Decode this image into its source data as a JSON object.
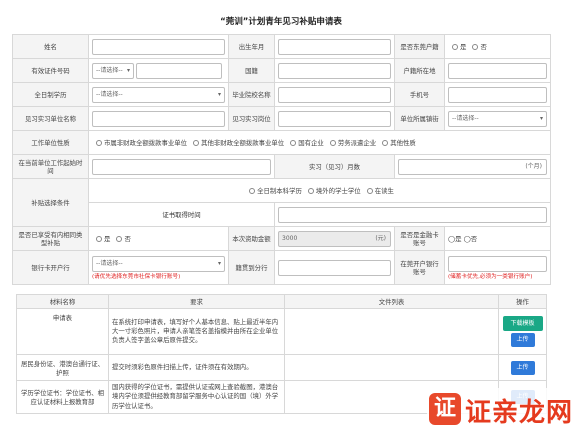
{
  "title": "“莞训”计划青年见习补贴申请表",
  "labels": {
    "name": "姓名",
    "birth": "出生年月",
    "dongguan_hukou": "是否东莞户籍",
    "id_type": "有效证件号码",
    "nationality": "国籍",
    "hukou_location": "户籍所在地",
    "education": "全日制学历",
    "school": "毕业院校名称",
    "phone": "手机号",
    "unit_name": "见习实习单位名称",
    "position": "见习实习岗位",
    "unit_town": "单位所属镇街",
    "unit_nature": "工作单位性质",
    "start_time": "在当前单位工作起始时间",
    "months": "实习（见习）月数",
    "subsidy_cond": "补贴选择条件",
    "cert_time": "证书取得时间",
    "enjoyed_other": "是否已享受有内相同类型补贴",
    "amount": "本次资助金额",
    "bank_card": "是否是金融卡账号",
    "bank_branch": "银行卡开户行",
    "city_branch": "籍贯到分行",
    "dongguan_bank": "在莞开户银行账号"
  },
  "placeholders": {
    "id_select": "--请选择--",
    "education_select": "--请选择--",
    "town_select": "--请选择--",
    "bank_select": "--请选择--"
  },
  "radios": {
    "yes": "是",
    "no": "否",
    "yes_no_compact": "◯是 ◯否"
  },
  "unit_natures": [
    "市属非财政全额拨款事业单位",
    "其他非财政全额拨款事业单位",
    "国有企业",
    "劳务派遣企业",
    "其他性质"
  ],
  "subsidy_options": [
    "全日制本科学历",
    "境外的学士学位",
    "在读生"
  ],
  "values": {
    "months_unit": "(个月)",
    "amount": "3000",
    "amount_unit": "(元)"
  },
  "hints": {
    "bank_hint": "(请优先选择东莞市社保卡银行账号)",
    "dongguan_hint": "(储蓄卡优先,必须为一类银行账户)"
  },
  "docs": {
    "headers": [
      "材料名称",
      "要求",
      "文件列表",
      "操作"
    ],
    "rows": [
      {
        "name": "申请表",
        "requirement": "在系统打印申请表，填写好个人基本信息、贴上最近半年内大一寸彩色照片，申请人亲笔签名盖指模并由所在企业单位负责人签字盖公章后原件提交。",
        "download": "下载模板",
        "upload": "上传"
      },
      {
        "name": "居民身份证、港澳台通行证、护照",
        "requirement": "提交时须彩色原件扫描上传，证件须在有效期内。",
        "upload": "上传"
      },
      {
        "name": "学历学位证书：学位证书、相应认证材料上报教育部",
        "requirement": "国内获得的学位证书，需提供认证或网上查验截图，港澳台境内学位须提供经教育部留学服务中心认证的国（境）外学历学位认证书。",
        "upload": "上传"
      }
    ]
  },
  "watermark": "证亲龙网",
  "colors": {
    "red_hint": "#e02020",
    "green_button": "#1aa886",
    "blue_button": "#2f7ad9",
    "watermark": "#e53a1e"
  }
}
